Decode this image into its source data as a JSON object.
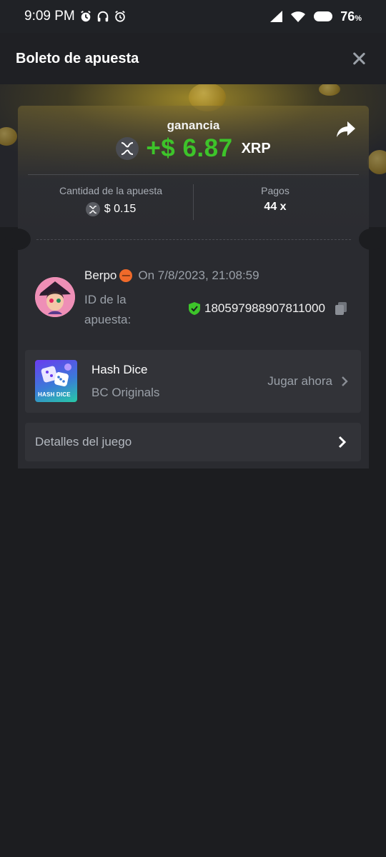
{
  "status_bar": {
    "time": "9:09 PM",
    "battery": "76",
    "battery_unit": "%"
  },
  "header": {
    "title": "Boleto de apuesta"
  },
  "ticket": {
    "win_label": "ganancia",
    "win_amount": "+$ 6.87",
    "currency": "XRP",
    "bet_amount_label": "Cantidad de la apuesta",
    "bet_amount_value": "$ 0.15",
    "payout_label": "Pagos",
    "payout_value": "44 x"
  },
  "user": {
    "name": "Berpo",
    "date": "On 7/8/2023, 21:08:59",
    "bet_id_label": "ID de la apuesta:",
    "bet_id": "180597988907811000"
  },
  "game": {
    "name": "Hash Dice",
    "provider": "BC Originals",
    "thumb_label": "HASH DICE",
    "play_label": "Jugar ahora"
  },
  "details": {
    "label": "Detalles del juego"
  },
  "colors": {
    "win_green": "#3dc42a",
    "background": "#1c1d20",
    "card": "#2a2b30"
  }
}
